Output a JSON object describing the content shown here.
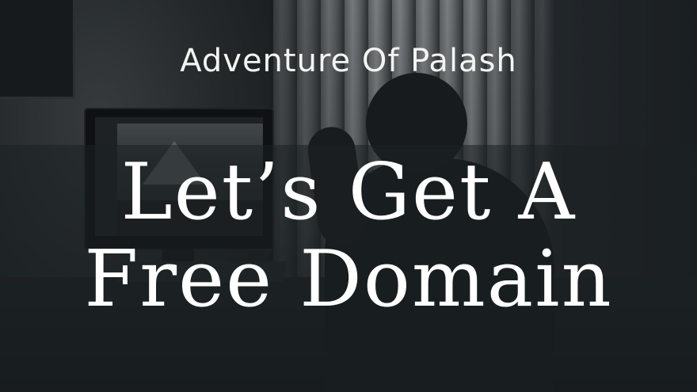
{
  "image": {
    "subtitle": "Adventure Of Palash",
    "headline_line1": "Let’s Get A",
    "headline_line2": "Free Domain",
    "colors": {
      "text": "#ffffff",
      "background": "#1b2024"
    }
  }
}
